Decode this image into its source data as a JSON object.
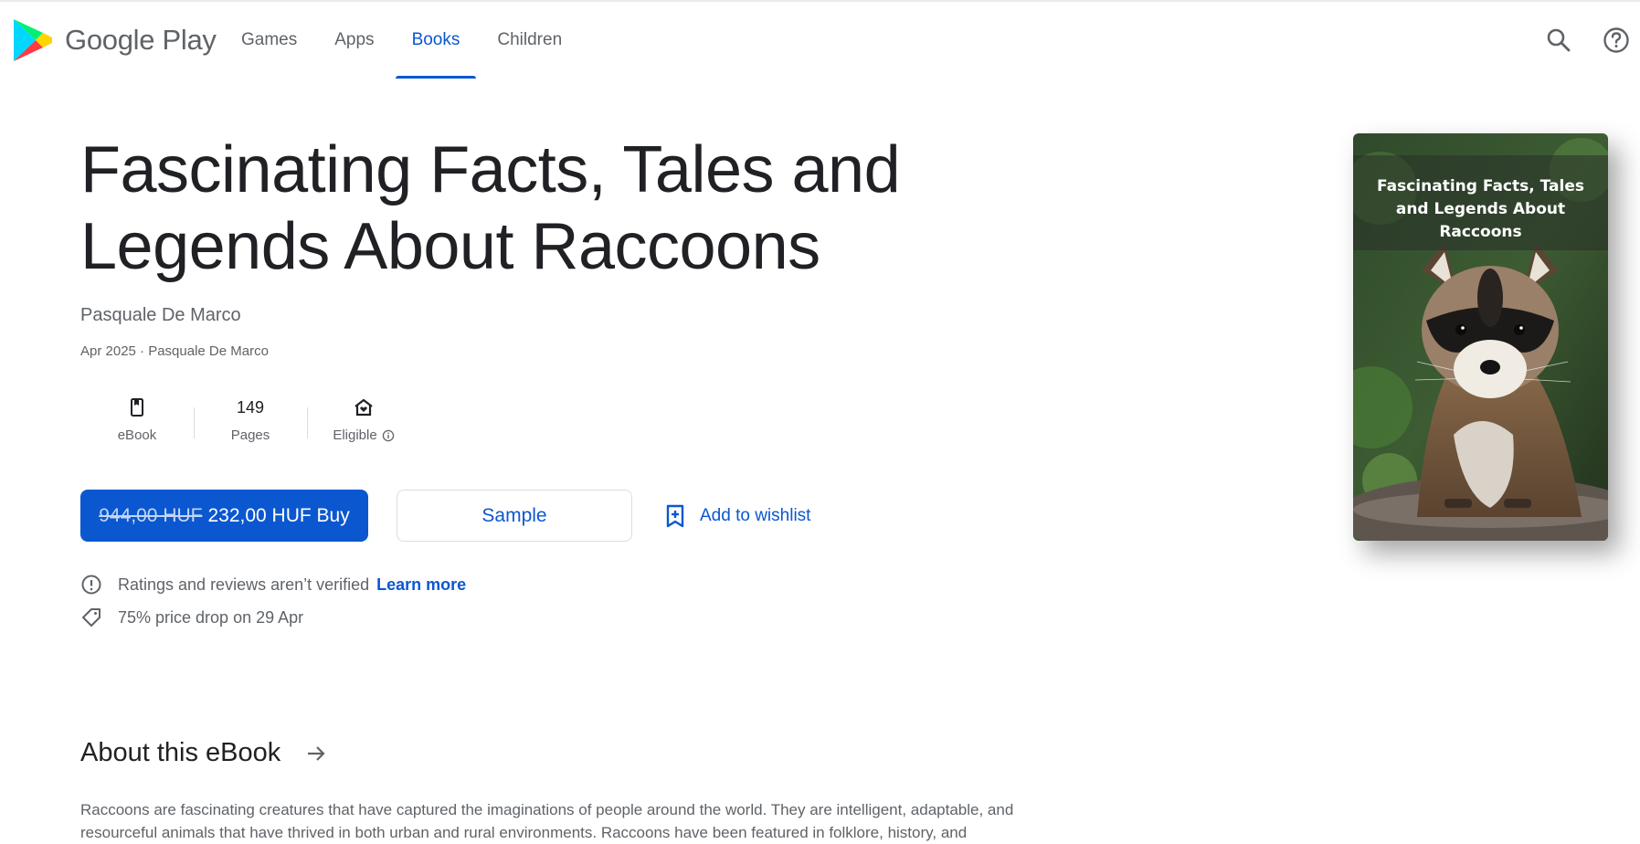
{
  "header": {
    "brand": "Google Play",
    "tabs": [
      {
        "label": "Games"
      },
      {
        "label": "Apps"
      },
      {
        "label": "Books"
      },
      {
        "label": "Children"
      }
    ],
    "active_tab": "Books"
  },
  "book": {
    "title": "Fascinating Facts, Tales and Legends About Raccoons",
    "author": "Pasquale De Marco",
    "meta": "Apr 2025 · Pasquale De Marco",
    "cover_title": "Fascinating Facts, Tales and Legends About Raccoons"
  },
  "stats": {
    "format_label": "eBook",
    "pages_value": "149",
    "pages_label": "Pages",
    "eligible_label": "Eligible"
  },
  "actions": {
    "old_price": "944,00 HUF",
    "buy_label": "232,00 HUF Buy",
    "sample_label": "Sample",
    "wishlist_label": "Add to wishlist"
  },
  "notes": {
    "ratings_text": "Ratings and reviews aren’t verified",
    "learn_more": "Learn more",
    "price_drop": "75% price drop on 29 Apr"
  },
  "about": {
    "title": "About this eBook",
    "description": "Raccoons are fascinating creatures that have captured the imaginations of people around the world. They are intelligent, adaptable, and resourceful animals that have thrived in both urban and rural environments. Raccoons have been featured in folklore, history, and"
  },
  "colors": {
    "accent": "#0b57d0",
    "text_primary": "#202124",
    "text_secondary": "#5f6368"
  },
  "icons": {
    "search": "search-icon",
    "help": "help-icon",
    "ebook": "ebook-icon",
    "family": "family-library-icon",
    "info": "info-icon",
    "wishlist": "bookmark-add-icon",
    "warning": "alert-circle-icon",
    "tag": "price-tag-icon",
    "arrow": "arrow-right-icon"
  }
}
